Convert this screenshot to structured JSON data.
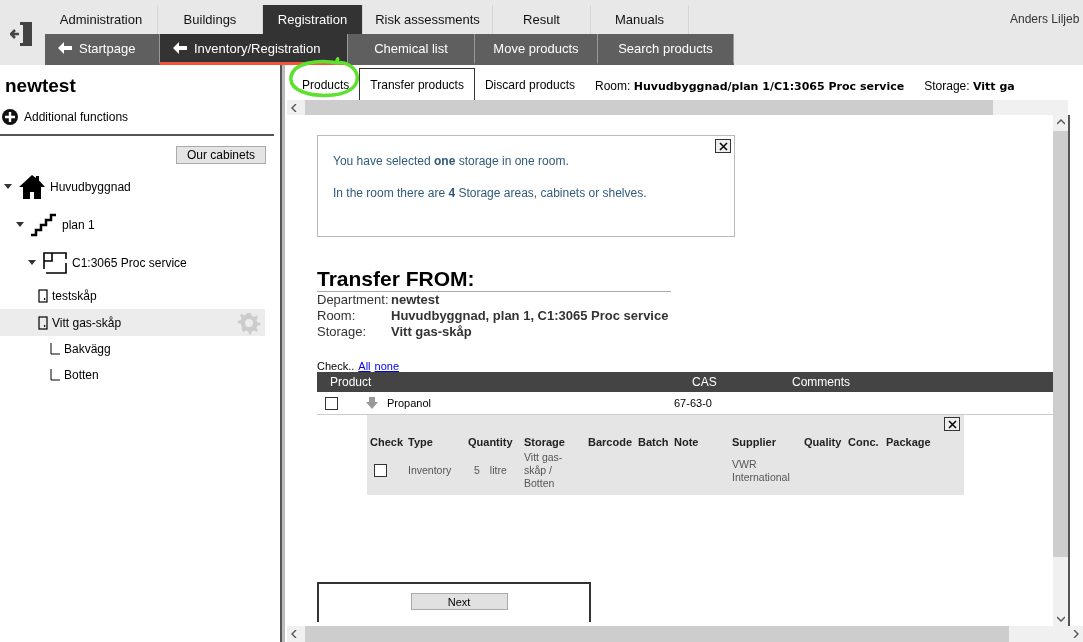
{
  "top_nav": {
    "tabs": [
      {
        "label": "Administration",
        "selected": false
      },
      {
        "label": "Buildings",
        "selected": false
      },
      {
        "label": "Registration",
        "selected": true
      },
      {
        "label": "Risk assessments",
        "selected": false
      },
      {
        "label": "Result",
        "selected": false
      },
      {
        "label": "Manuals",
        "selected": false
      }
    ],
    "user": "Anders Liljeb"
  },
  "sub_nav": [
    {
      "label": "Startpage",
      "kind": "back",
      "selected": false
    },
    {
      "label": "Inventory/Registration",
      "kind": "back",
      "selected": true
    },
    {
      "label": "Chemical list",
      "kind": "plain",
      "selected": false
    },
    {
      "label": "Move products",
      "kind": "plain",
      "selected": false
    },
    {
      "label": "Search products",
      "kind": "plain",
      "selected": false
    }
  ],
  "sidebar": {
    "title": "newtest",
    "additional": "Additional functions",
    "cabinets_button": "Our cabinets",
    "tree": [
      {
        "label": "Huvudbyggnad",
        "kind": "building",
        "expanded": true,
        "selected": false,
        "children": [
          {
            "label": "plan 1",
            "kind": "floor",
            "expanded": true,
            "selected": false,
            "children": [
              {
                "label": "C1:3065 Proc service",
                "kind": "room",
                "expanded": true,
                "selected": false,
                "children": [
                  {
                    "label": "testskåp",
                    "kind": "cabinet",
                    "selected": false
                  },
                  {
                    "label": "Vitt gas-skåp",
                    "kind": "cabinet",
                    "selected": true,
                    "children": [
                      {
                        "label": "Bakvägg",
                        "kind": "shelf",
                        "selected": false
                      },
                      {
                        "label": "Botten",
                        "kind": "shelf",
                        "selected": false
                      }
                    ]
                  }
                ]
              }
            ]
          }
        ]
      }
    ]
  },
  "content_tabs": [
    {
      "label": "Products",
      "selected": false
    },
    {
      "label": "Transfer products",
      "selected": true
    },
    {
      "label": "Discard products",
      "selected": false
    }
  ],
  "location": {
    "room_label": "Room:",
    "room": "Huvudbyggnad/plan 1/C1:3065 Proc service",
    "storage_label": "Storage:",
    "storage": "Vitt ga"
  },
  "info_box": {
    "lines": [
      "You have selected **one** storage in one room.",
      "In the room there are **4** Storage areas, cabinets or shelves."
    ]
  },
  "transfer": {
    "heading": "Transfer FROM:",
    "fields": [
      {
        "label": "Department:",
        "value": "newtest"
      },
      {
        "label": "Room:",
        "value": "Huvudbyggnad, plan 1, C1:3065 Proc service"
      },
      {
        "label": "Storage:",
        "value": "Vitt gas-skåp"
      }
    ]
  },
  "check_links": {
    "label": "Check..",
    "links": [
      "All",
      "none"
    ]
  },
  "products_table": {
    "columns": [
      "Product",
      "CAS",
      "Comments"
    ],
    "rows": [
      {
        "checked": false,
        "name": "Propanol",
        "cas": "67-63-0"
      }
    ],
    "detail": {
      "columns": [
        "Check",
        "Type",
        "Quantity",
        "Storage",
        "Barcode",
        "Batch",
        "Note",
        "Supplier",
        "Quality",
        "Conc.",
        "Package"
      ],
      "rows": [
        {
          "checked": false,
          "type": "Inventory",
          "quantity": "5",
          "unit": "litre",
          "storage": "Vitt gas-skåp / Botten",
          "supplier": "VWR International"
        }
      ]
    }
  },
  "next_button": "Next"
}
